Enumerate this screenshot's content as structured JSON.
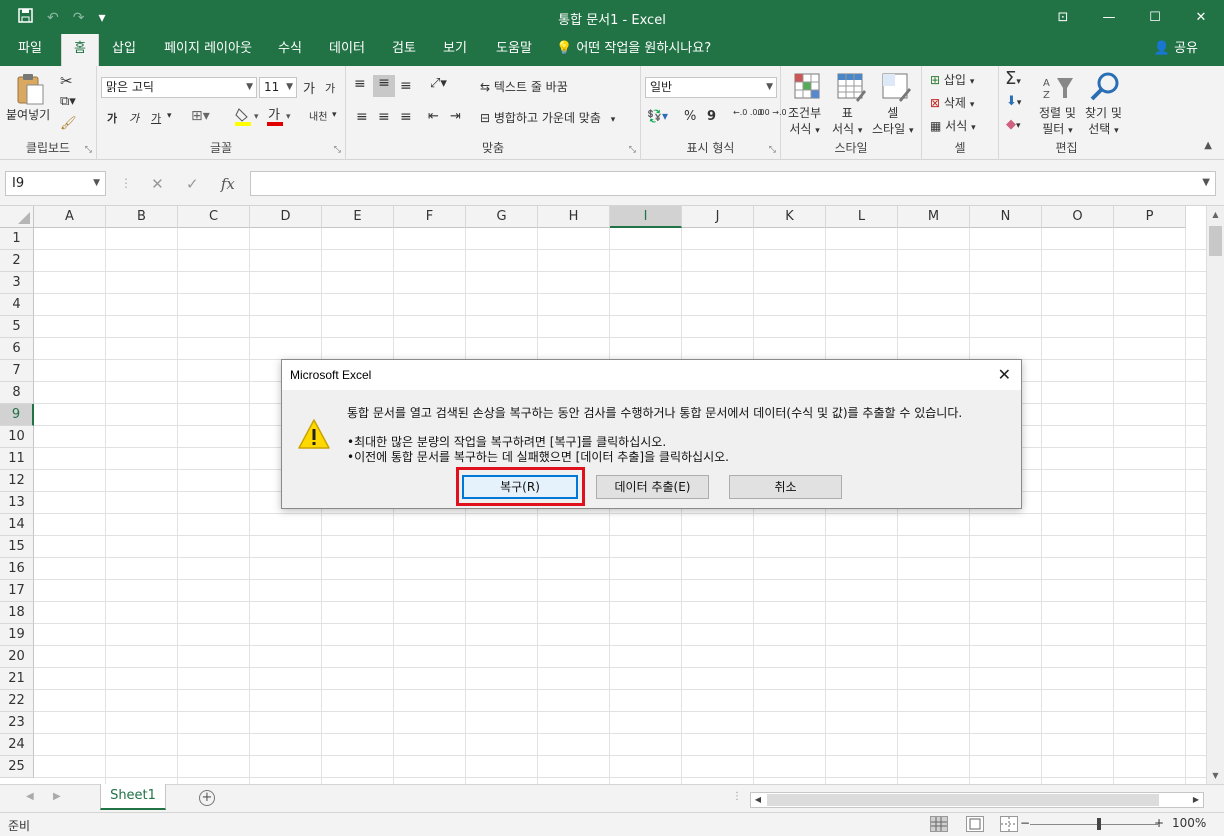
{
  "window": {
    "title": "통합 문서1  -  Excel",
    "controls": [
      "⊡",
      "—",
      "☐",
      "✕"
    ]
  },
  "qat": {
    "save_icon": "save-icon",
    "undo": "↶",
    "redo": "↷",
    "customize": "▾"
  },
  "tabs": [
    "파일",
    "홈",
    "삽입",
    "페이지 레이아웃",
    "수식",
    "데이터",
    "검토",
    "보기",
    "도움말"
  ],
  "tell_me": "어떤 작업을 원하시나요?",
  "share": "공유",
  "ribbon": {
    "clipboard": {
      "paste": "붙여넣기",
      "label": "클립보드"
    },
    "font": {
      "font_name": "맑은 고딕",
      "font_size": "11",
      "grow": "가",
      "shrink": "가",
      "bold": "가",
      "italic": "가",
      "underline": "가",
      "color_a": "가",
      "phonetic": "내천",
      "label": "글꼴"
    },
    "alignment": {
      "wrap_text": "텍스트 줄 바꿈",
      "merge_center": "병합하고 가운데 맞춤",
      "label": "맞춤"
    },
    "number": {
      "format": "일반",
      "percent": "%",
      "comma": "9",
      "inc_decimal": "←.0 .00",
      "dec_decimal": ".00 →.0",
      "label": "표시 형식"
    },
    "styles": {
      "conditional": [
        "조건부",
        "서식"
      ],
      "table": [
        "표",
        "서식"
      ],
      "cell_styles": [
        "셀",
        "스타일"
      ],
      "label": "스타일"
    },
    "cells": {
      "insert": "삽입",
      "delete": "삭제",
      "format": "서식",
      "label": "셀"
    },
    "editing": {
      "sort_filter": [
        "정렬 및",
        "필터"
      ],
      "find_select": [
        "찾기 및",
        "선택"
      ],
      "label": "편집"
    }
  },
  "formula_bar": {
    "name_box": "I9",
    "cancel": "✕",
    "enter": "✓",
    "fx": "fx",
    "value": ""
  },
  "columns": [
    "A",
    "B",
    "C",
    "D",
    "E",
    "F",
    "G",
    "H",
    "I",
    "J",
    "K",
    "L",
    "M",
    "N",
    "O",
    "P"
  ],
  "rows": [
    "1",
    "2",
    "3",
    "4",
    "5",
    "6",
    "7",
    "8",
    "9",
    "10",
    "11",
    "12",
    "13",
    "14",
    "15",
    "16",
    "17",
    "18",
    "19",
    "20",
    "21",
    "22",
    "23",
    "24",
    "25"
  ],
  "active_cell": {
    "column": "I",
    "row": "9"
  },
  "sheets": [
    "Sheet1"
  ],
  "status": {
    "ready": "준비",
    "zoom": "100%",
    "zoom_out": "−",
    "zoom_in": "+"
  },
  "dialog": {
    "title": "Microsoft Excel",
    "close": "✕",
    "message": "통합 문서를 열고 검색된 손상을 복구하는 동안 검사를 수행하거나 통합 문서에서 데이터(수식 및 값)를 추출할 수 있습니다.",
    "bullet1": "•최대한 많은 분량의 작업을 복구하려면 [복구]를 클릭하십시오.",
    "bullet2": "•이전에 통합 문서를 복구하는 데 실패했으면 [데이터 추출]을 클릭하십시오.",
    "repair_button": "복구(R)",
    "extract_button": "데이터 추출(E)",
    "cancel_button": "취소"
  },
  "colors": {
    "excel_green": "#217346",
    "highlight_red": "#e0111d",
    "dialog_focus": "#0078d7"
  }
}
